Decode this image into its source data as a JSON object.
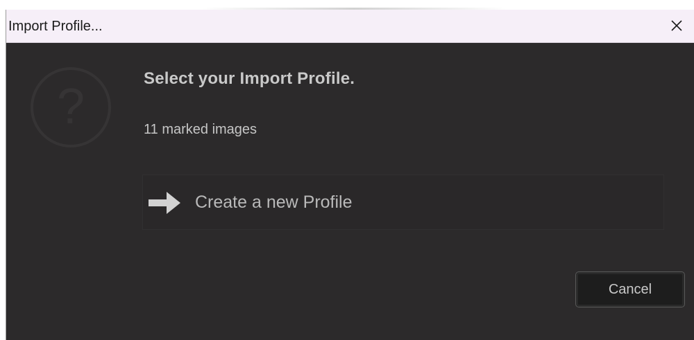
{
  "window": {
    "title": "Import Profile...",
    "close_icon": "close-icon"
  },
  "dialog": {
    "icon": "question-icon",
    "heading": "Select your Import Profile.",
    "marked_images": "11 marked images",
    "create_profile": {
      "icon": "arrow-right-icon",
      "label": "Create a new Profile"
    },
    "cancel_label": "Cancel"
  },
  "colors": {
    "background": "#2c2a2b",
    "titlebar": "#f6eff8",
    "text": "#c9c9c9",
    "button_bg": "#1d1d1d"
  }
}
